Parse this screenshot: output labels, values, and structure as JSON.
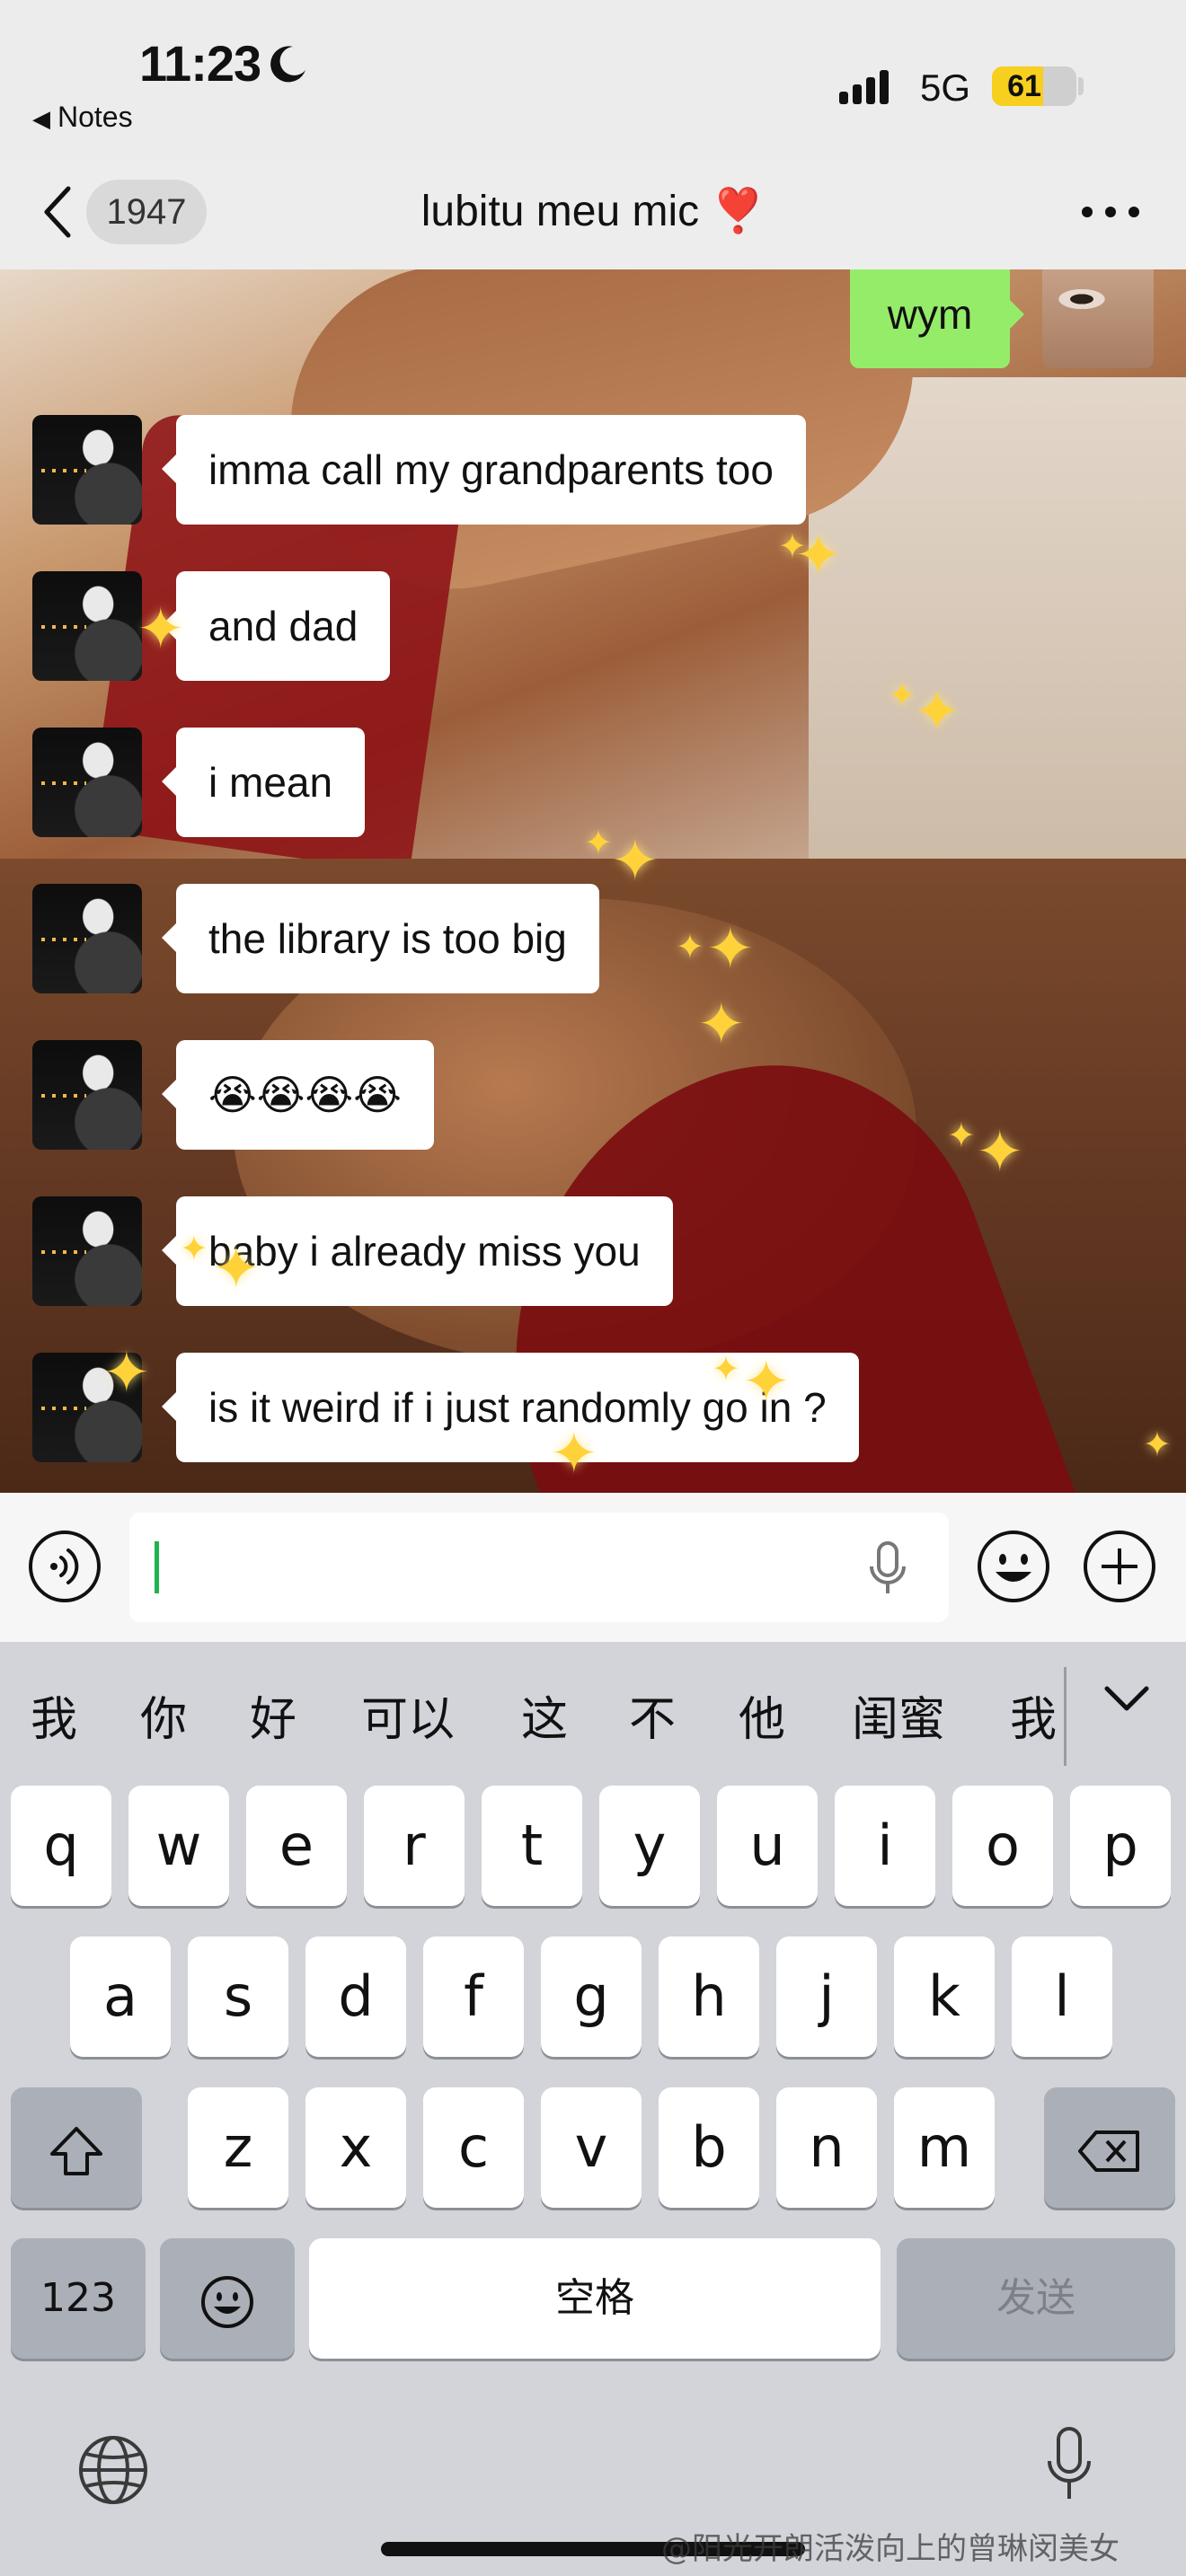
{
  "status_bar": {
    "time": "11:23",
    "back_app": "Notes",
    "network": "5G",
    "battery": "61",
    "battery_fraction": 0.61
  },
  "nav": {
    "unread_count": "1947",
    "title": "lubitu meu mic",
    "title_emoji": "❣️"
  },
  "messages": {
    "outgoing": "wym",
    "incoming": [
      "imma call my grandparents too",
      "and dad",
      "i mean",
      "the library is too big",
      "😭😭😭😭",
      "baby i already miss you",
      "is it weird if i just randomly go in ?"
    ]
  },
  "input": {
    "value": "",
    "placeholder": ""
  },
  "candidates": [
    "我",
    "你",
    "好",
    "可以",
    "这",
    "不",
    "他",
    "闺蜜",
    "我"
  ],
  "keyboard": {
    "row1": [
      "q",
      "w",
      "e",
      "r",
      "t",
      "y",
      "u",
      "i",
      "o",
      "p"
    ],
    "row2": [
      "a",
      "s",
      "d",
      "f",
      "g",
      "h",
      "j",
      "k",
      "l"
    ],
    "row3": [
      "z",
      "x",
      "c",
      "v",
      "b",
      "n",
      "m"
    ],
    "numbers_key": "123",
    "space_key": "空格",
    "send_key": "发送"
  },
  "watermark": "@阳光开朗活泼向上的曾琳闵美女",
  "colors": {
    "outgoing_bubble": "#95ec69",
    "incoming_bubble": "#ffffff",
    "caret": "#1fb34e",
    "battery": "#f7cf1e"
  }
}
